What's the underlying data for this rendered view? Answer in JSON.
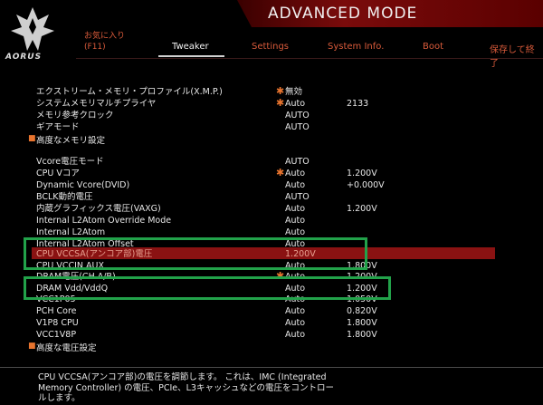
{
  "header": {
    "brand": "AORUS",
    "mode_title": "ADVANCED MODE",
    "favorites_line1": "お気に入り",
    "favorites_line2": "(F11)",
    "tabs": [
      {
        "label": "Tweaker",
        "active": true
      },
      {
        "label": "Settings",
        "active": false
      },
      {
        "label": "System Info.",
        "active": false
      },
      {
        "label": "Boot",
        "active": false
      }
    ],
    "save_exit": "保存して終了"
  },
  "memory": [
    {
      "label": "エクストリーム・メモリ・プロファイル(X.M.P.)",
      "star": true,
      "value": "無効",
      "value2": ""
    },
    {
      "label": "システムメモリマルチプライヤ",
      "star": true,
      "value": "Auto",
      "value2": "2133"
    },
    {
      "label": "メモリ参考クロック",
      "star": false,
      "value": "AUTO",
      "value2": ""
    },
    {
      "label": "ギアモード",
      "star": false,
      "value": "AUTO",
      "value2": ""
    }
  ],
  "memory_sub": "高度なメモリ設定",
  "voltage": [
    {
      "label": "Vcore電圧モード",
      "star": false,
      "value": "AUTO",
      "value2": ""
    },
    {
      "label": "CPU Vコア",
      "star": true,
      "value": "Auto",
      "value2": "1.200V"
    },
    {
      "label": "Dynamic Vcore(DVID)",
      "star": false,
      "value": "Auto",
      "value2": "+0.000V"
    },
    {
      "label": "BCLK動的電圧",
      "star": false,
      "value": "AUTO",
      "value2": ""
    },
    {
      "label": "内蔵グラフィックス電圧(VAXG)",
      "star": false,
      "value": "Auto",
      "value2": "1.200V"
    },
    {
      "label": "Internal L2Atom Override Mode",
      "star": false,
      "value": "Auto",
      "value2": ""
    },
    {
      "label": "Internal L2Atom",
      "star": false,
      "value": "Auto",
      "value2": ""
    },
    {
      "label": "Internal L2Atom Offset",
      "star": false,
      "value": "Auto",
      "value2": ""
    },
    {
      "label": "CPU VCCSA(アンコア部)電圧",
      "star": false,
      "value": "1.200V",
      "value2": ""
    },
    {
      "label": "CPU VCCIN AUX",
      "star": false,
      "value": "Auto",
      "value2": "1.800V"
    },
    {
      "label": "DRAM電圧(CH A/B)",
      "star": true,
      "value": "Auto",
      "value2": "1.200V"
    },
    {
      "label": "DRAM Vdd/VddQ",
      "star": false,
      "value": "Auto",
      "value2": "1.200V"
    },
    {
      "label": "VCC1P05",
      "star": false,
      "value": "Auto",
      "value2": "1.050V"
    },
    {
      "label": "PCH Core",
      "star": false,
      "value": "Auto",
      "value2": "0.820V"
    },
    {
      "label": "V1P8 CPU",
      "star": false,
      "value": "Auto",
      "value2": "1.800V"
    },
    {
      "label": "VCC1V8P",
      "star": false,
      "value": "Auto",
      "value2": "1.800V"
    }
  ],
  "voltage_sub": "高度な電圧設定",
  "help_text": "CPU VCCSA(アンコア部)の電圧を調節します。 これは、IMC (Integrated Memory Controller) の電圧、PCIe、L3キャッシュなどの電圧をコントロールします。",
  "colors": {
    "accent": "#d85a3a",
    "highlight": "#8a1212",
    "annotation": "#22a24a"
  }
}
